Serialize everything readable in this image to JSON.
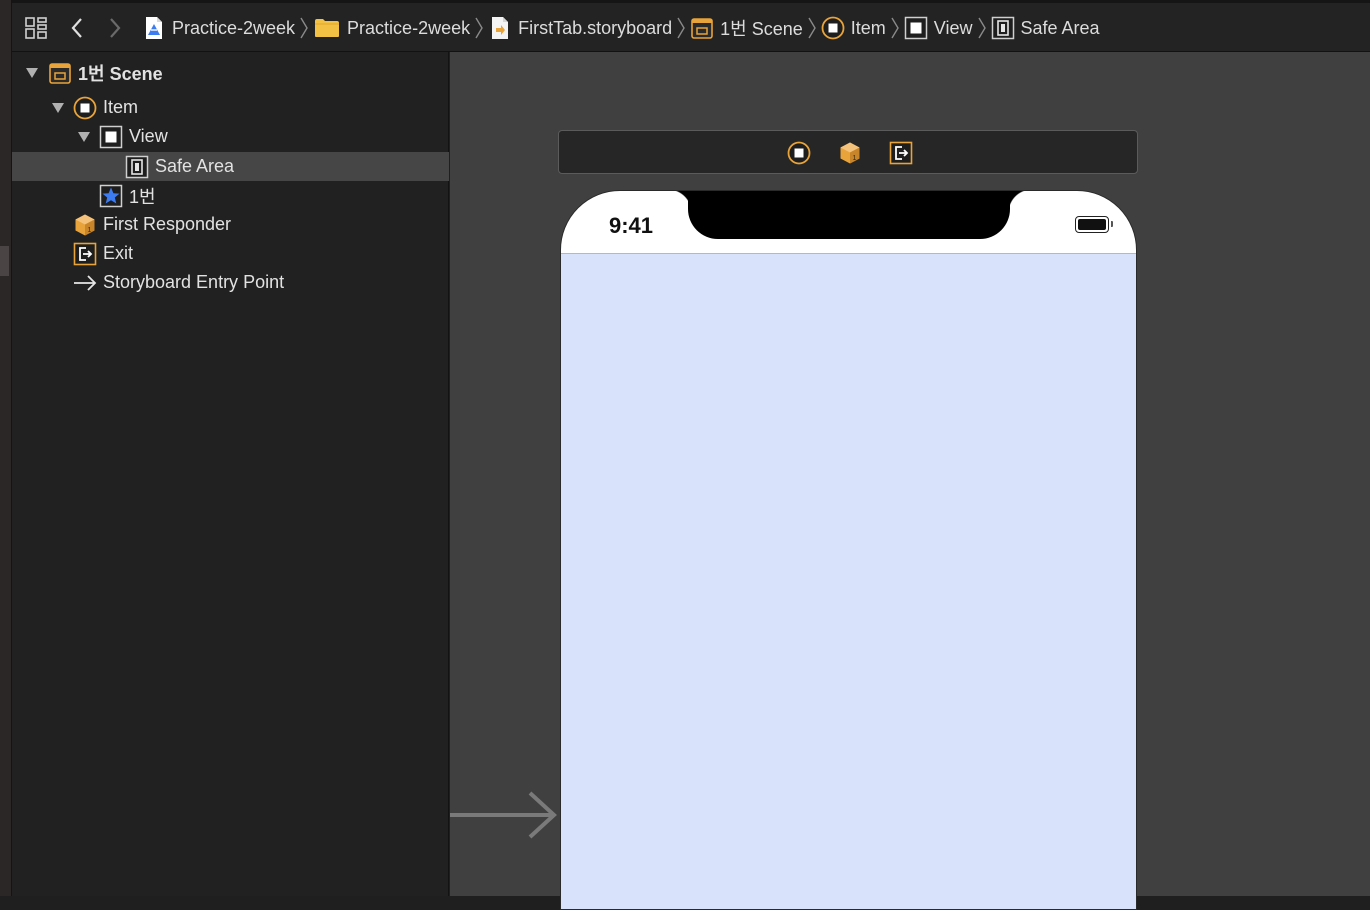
{
  "toolbar": {
    "related_items_icon": "related-items-grid-icon",
    "back_icon": "chevron-left-icon",
    "forward_icon": "chevron-right-icon"
  },
  "breadcrumbs": [
    {
      "label": "Practice-2week",
      "icon": "xcode-project-icon"
    },
    {
      "label": "Practice-2week",
      "icon": "folder-icon"
    },
    {
      "label": "FirstTab.storyboard",
      "icon": "storyboard-file-icon"
    },
    {
      "label": "1번 Scene",
      "icon": "scene-icon"
    },
    {
      "label": "Item",
      "icon": "view-controller-icon"
    },
    {
      "label": "View",
      "icon": "view-icon"
    },
    {
      "label": "Safe Area",
      "icon": "safe-area-icon"
    }
  ],
  "outline": {
    "items": [
      {
        "label": "1번 Scene",
        "icon": "scene-icon",
        "expanded": true
      },
      {
        "label": "Item",
        "icon": "view-controller-icon",
        "expanded": true
      },
      {
        "label": "View",
        "icon": "view-icon",
        "expanded": true
      },
      {
        "label": "Safe Area",
        "icon": "safe-area-icon",
        "selected": true
      },
      {
        "label": "1번",
        "icon": "tab-bar-item-star-icon"
      },
      {
        "label": "First Responder",
        "icon": "first-responder-cube-icon"
      },
      {
        "label": "Exit",
        "icon": "exit-icon"
      },
      {
        "label": "Storyboard Entry Point",
        "icon": "arrow-right-icon"
      }
    ]
  },
  "canvas": {
    "scene_bar_icons": [
      "view-controller-icon",
      "first-responder-cube-icon",
      "exit-icon"
    ],
    "device": {
      "status_time": "9:41",
      "battery_icon": "battery-full-icon"
    }
  },
  "colors": {
    "accent_gold": "#e8a33a",
    "selection": "#464646",
    "safe_area_fill": "#d9e2fb",
    "canvas_bg": "#404040",
    "panel_bg": "#212121"
  }
}
